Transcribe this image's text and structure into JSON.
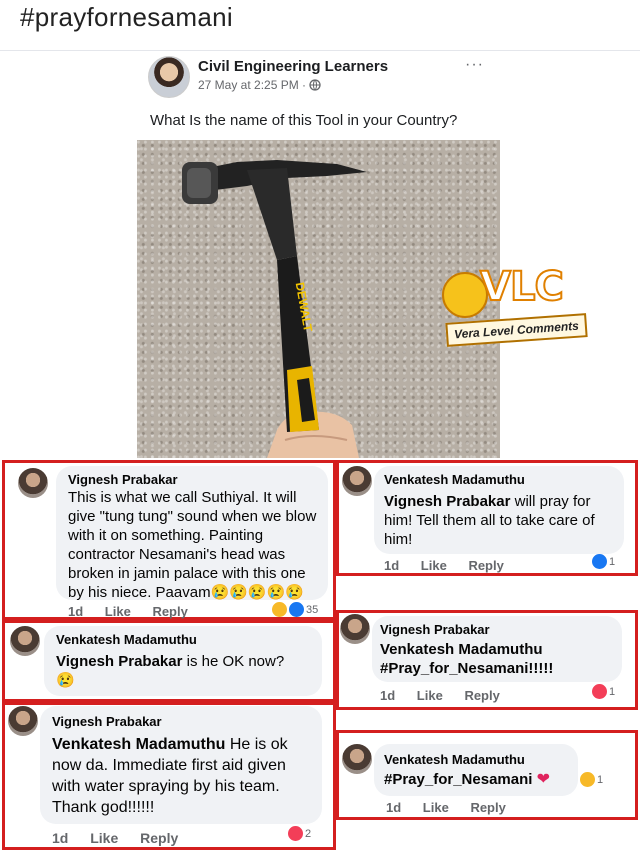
{
  "hashtag": "#prayfornesamani",
  "post": {
    "page_name": "Civil Engineering Learners",
    "time": "27 May at 2:25 PM ·",
    "more": "···",
    "text": "What Is the name of this Tool in your Country?",
    "photo_brand": "DEWALT",
    "logo": {
      "letters": "VLC",
      "tagline": "Vera Level Comments"
    }
  },
  "colors": {
    "highlight_box": "#d41f1f",
    "bubble": "#f0f2f5",
    "fb_blue": "#1877f2"
  },
  "comments": [
    {
      "author": "Vignesh Prabakar",
      "text": "This is what we call Suthiyal. It will give \"tung tung\" sound when we blow with it on something. Painting contractor Nesamani's head was broken in jamin palace with this one by his niece. Paavam",
      "emoji": "😢😢😢😢😢",
      "time": "1d",
      "like": "Like",
      "reply": "Reply",
      "reaction_count": "35"
    },
    {
      "author": "Venkatesh Madamuthu",
      "mention": "Vignesh Prabakar",
      "text": " will pray for him!  Tell them all to take care of him!",
      "time": "1d",
      "like": "Like",
      "reply": "Reply",
      "reaction_count": "1"
    },
    {
      "author": "Venkatesh Madamuthu",
      "mention": "Vignesh Prabakar",
      "text": "  is he OK now?",
      "emoji": "😢"
    },
    {
      "author": "Vignesh Prabakar",
      "mention": "Venkatesh Madamuthu",
      "text": "#Pray_for_Nesamani!!!!!",
      "time": "1d",
      "like": "Like",
      "reply": "Reply",
      "reaction_count": "1"
    },
    {
      "author": "Vignesh Prabakar",
      "mention": "Venkatesh Madamuthu",
      "text": " He is ok now da.  Immediate first aid given with water spraying by his team. Thank god!!!!!!",
      "time": "1d",
      "like": "Like",
      "reply": "Reply",
      "reaction_count": "2"
    },
    {
      "author": "Venkatesh Madamuthu",
      "text": "#Pray_for_Nesamani",
      "time": "1d",
      "like": "Like",
      "reply": "Reply",
      "reaction_count": "1"
    }
  ]
}
